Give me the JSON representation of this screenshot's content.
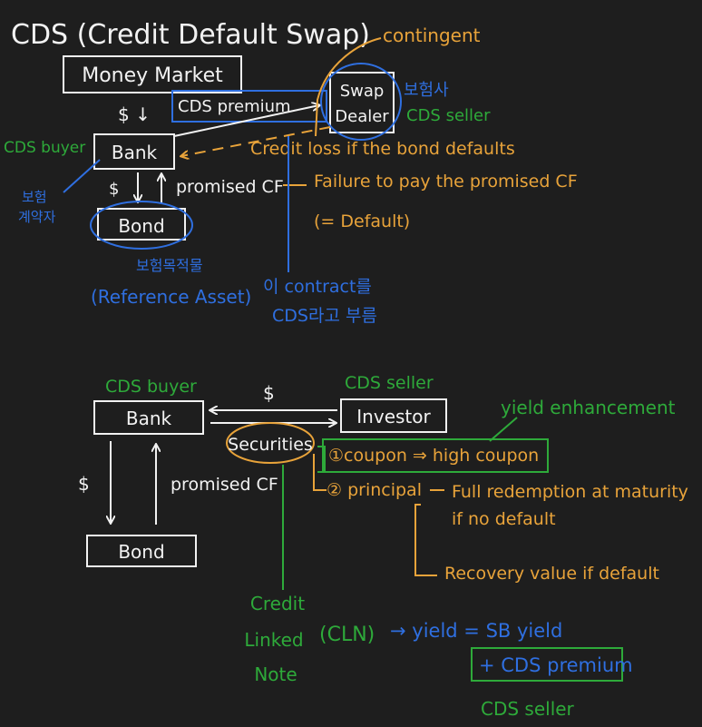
{
  "colors": {
    "background": "#1e1e1e",
    "ink_white": "#f2f2f2",
    "ink_orange": "#e8a33a",
    "ink_blue": "#2f6fe0",
    "ink_green": "#2eaa3a"
  },
  "diagram1": {
    "title": "CDS (Credit Default Swap)",
    "money_market": "Money Market",
    "dollar_down_top": "$ ↓",
    "cds_premium": "CDS premium",
    "bank": "Bank",
    "cds_buyer": "CDS buyer",
    "swap_dealer_line1": "Swap",
    "swap_dealer_line2": "Dealer",
    "contingent": "contingent",
    "insurer_kr": "보험사",
    "cds_seller": "CDS seller",
    "credit_loss": "Credit loss if the bond defaults",
    "policyholder_kr_line1": "보험",
    "policyholder_kr_line2": "계약자",
    "dollar_bond": "$",
    "promised_cf": "promised CF",
    "failure_line1": "Failure to pay the promised CF",
    "failure_line2": "(= Default)",
    "bond": "Bond",
    "insured_object_kr": "보험목적물",
    "reference_asset": "(Reference Asset)",
    "contract_note_line1": "이 contract를",
    "contract_note_line2": "CDS라고 부름"
  },
  "diagram2": {
    "cds_buyer": "CDS buyer",
    "dollar": "$",
    "cds_seller_top": "CDS seller",
    "bank": "Bank",
    "investor": "Investor",
    "securities": "Securities",
    "yield_enhancement": "yield enhancement",
    "coupon": "①coupon ⇒ high coupon",
    "principal": "② principal",
    "full_redemption_line1": "Full redemption at maturity",
    "full_redemption_line2": "if no default",
    "recovery": "Recovery value if default",
    "dollar_left": "$",
    "promised_cf": "promised CF",
    "bond": "Bond",
    "cln_line1": "Credit",
    "cln_line2": "Linked",
    "cln_line3": "Note",
    "cln_abbr": "(CLN)",
    "yield_eq": "→ yield = SB yield",
    "cds_premium": "+ CDS premium",
    "cds_seller_bottom": "CDS seller"
  }
}
